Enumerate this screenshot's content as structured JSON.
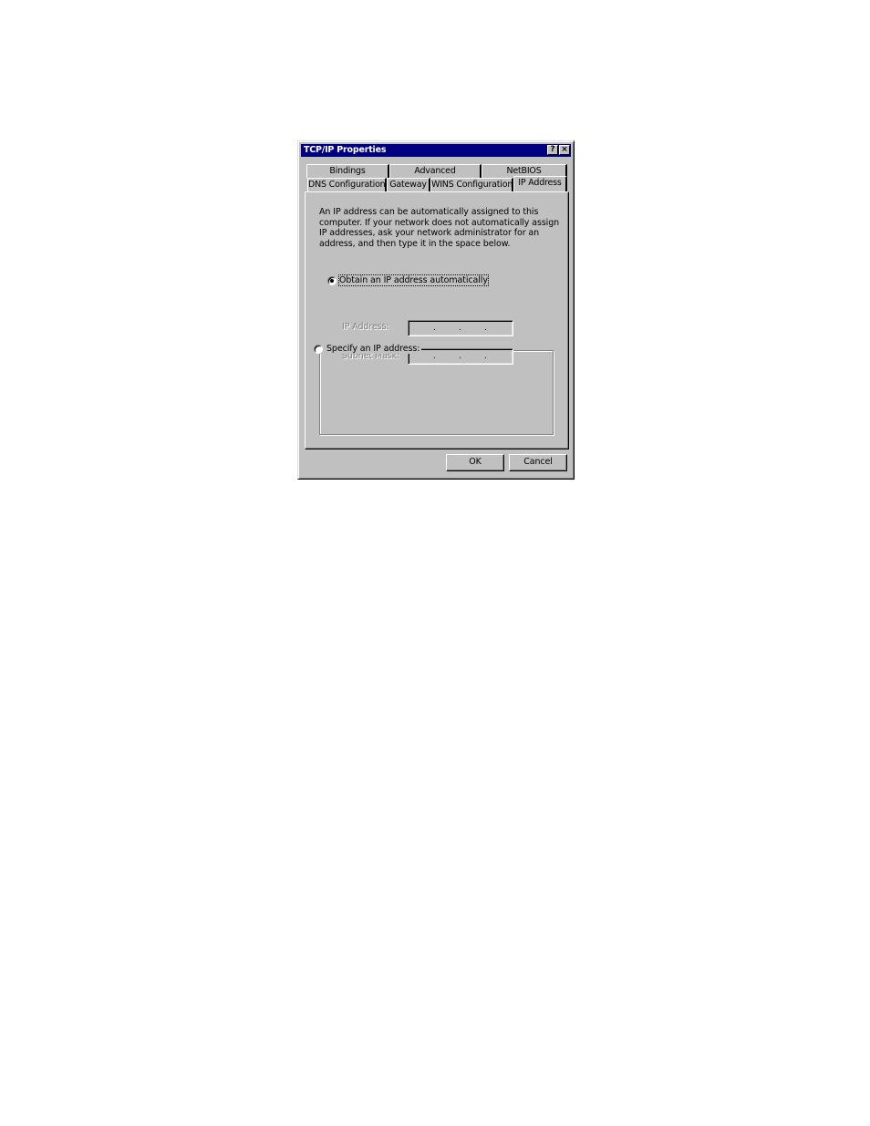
{
  "window": {
    "title": "TCP/IP Properties",
    "help_button": "?",
    "close_button": "×"
  },
  "tabs": {
    "back_row": [
      "Bindings",
      "Advanced",
      "NetBIOS"
    ],
    "front_row": [
      "DNS Configuration",
      "Gateway",
      "WINS Configuration",
      "IP Address"
    ],
    "active": "IP Address"
  },
  "ip_address_panel": {
    "description": "An IP address can be automatically assigned to this computer. If your network does not automatically assign IP addresses, ask your network administrator for an address, and then type it in the space below.",
    "option_obtain": {
      "label": "Obtain an IP address automatically",
      "selected": true
    },
    "option_specify": {
      "label": "Specify an IP address:",
      "selected": false
    },
    "ip_address": {
      "label": "IP Address:",
      "value": [
        "",
        "",
        "",
        ""
      ],
      "enabled": false
    },
    "subnet_mask": {
      "label": "Subnet Mask:",
      "value": [
        "",
        "",
        "",
        ""
      ],
      "enabled": false
    }
  },
  "buttons": {
    "ok": "OK",
    "cancel": "Cancel"
  }
}
